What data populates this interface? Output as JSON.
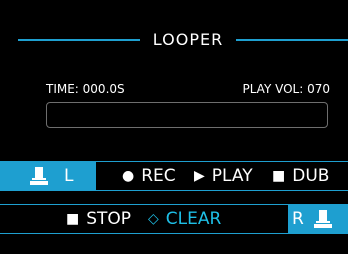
{
  "header": {
    "title": "LOOPER"
  },
  "info": {
    "time": "TIME: 000.0S",
    "play_vol": "PLAY VOL: 070"
  },
  "progress": {
    "fraction": 0.0
  },
  "row1": {
    "pedal_letter": "L",
    "rec": {
      "glyph": "●",
      "label": "REC"
    },
    "play": {
      "glyph": "▶",
      "label": "PLAY"
    },
    "dub": {
      "glyph": "■",
      "label": "DUB"
    }
  },
  "row2": {
    "stop": {
      "glyph": "■",
      "label": "STOP"
    },
    "clear": {
      "glyph": "◇",
      "label": "CLEAR"
    },
    "pedal_letter": "R"
  },
  "colors": {
    "accent": "#1e9fd0",
    "clear_text": "#1ebfe6",
    "background": "#000000"
  },
  "icons": {
    "pedal": "footswitch-icon"
  }
}
